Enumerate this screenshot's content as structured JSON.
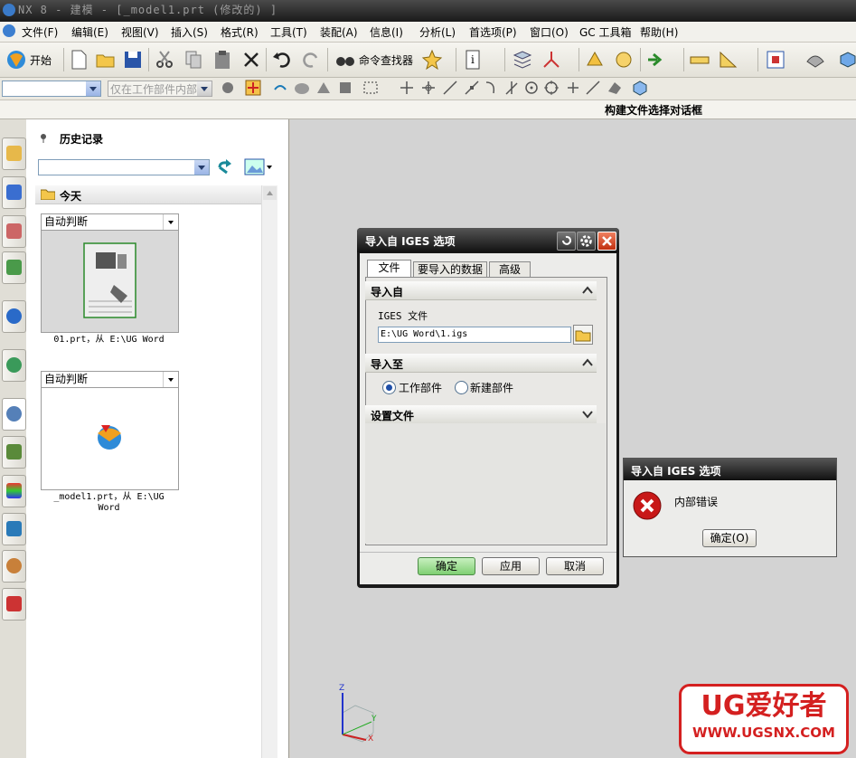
{
  "window": {
    "title": "NX 8 - 建模 - [_model1.prt  (修改的) ]"
  },
  "menu": [
    "文件(F)",
    "编辑(E)",
    "视图(V)",
    "插入(S)",
    "格式(R)",
    "工具(T)",
    "装配(A)",
    "信息(I)",
    "分析(L)",
    "首选项(P)",
    "窗口(O)",
    "GC 工具箱",
    "帮助(H)"
  ],
  "toolbar": {
    "start_label": "开始",
    "command_finder_label": "命令查找器",
    "selection_filter_placeholder": "",
    "selection_scope": "仅在工作部件内部"
  },
  "cue_line": "构建文件选择对话框",
  "history": {
    "title": "历史记录",
    "search_value": "",
    "group_label": "今天",
    "items": [
      {
        "mode": "自动判断",
        "caption": "01.prt，从 E:\\UG Word"
      },
      {
        "mode": "自动判断",
        "caption": "_model1.prt，从 E:\\UG Word"
      }
    ]
  },
  "import_dialog": {
    "title": "导入自 IGES 选项",
    "tabs": [
      "文件",
      "要导入的数据",
      "高级"
    ],
    "group_import_from": "导入自",
    "file_label": "IGES 文件",
    "file_value": "E:\\UG Word\\1.igs",
    "group_import_to": "导入至",
    "radio_work_part": "工作部件",
    "radio_new_part": "新建部件",
    "group_settings_file": "设置文件",
    "ok": "确定",
    "apply": "应用",
    "cancel": "取消"
  },
  "error_dialog": {
    "title": "导入自 IGES 选项",
    "message": "内部错误",
    "ok": "确定(O)"
  },
  "triad": {
    "z": "Z",
    "y": "Y",
    "x": "X"
  },
  "watermark": {
    "brand": "UG爱好者",
    "url": "WWW.UGSNX.COM"
  },
  "colors": {
    "ok_green": "#7fcf72",
    "error_red": "#d42020",
    "titlebar": "#1a1a1a"
  }
}
